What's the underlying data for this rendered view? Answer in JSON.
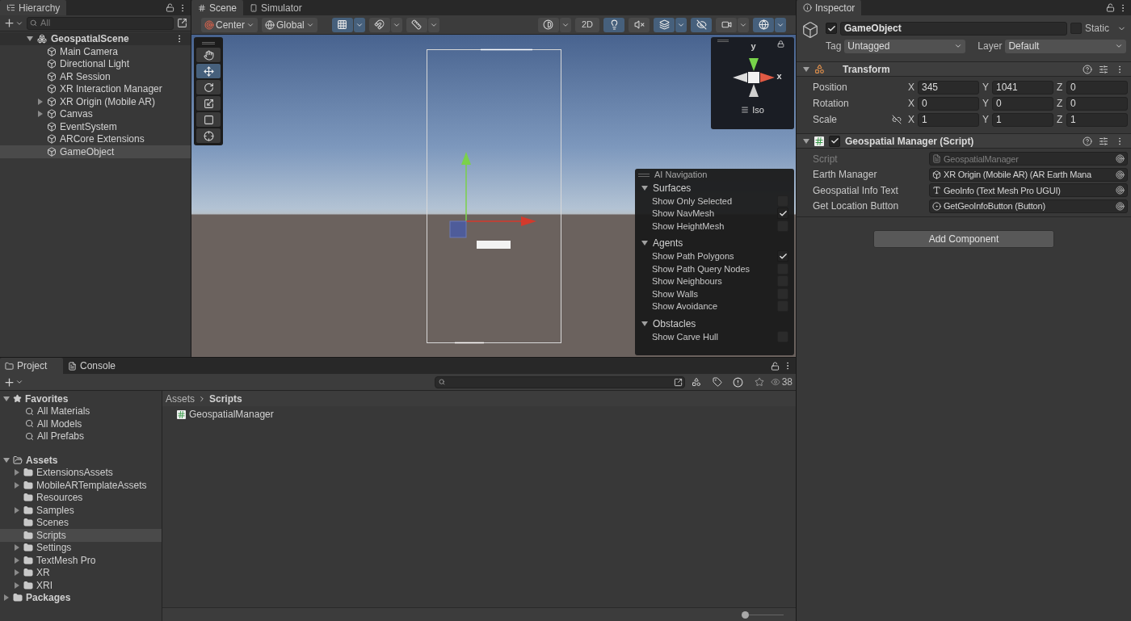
{
  "hierarchy": {
    "tab": "Hierarchy",
    "search_placeholder": "All",
    "scene": "GeospatialScene",
    "items": [
      {
        "label": "Main Camera",
        "expandable": false,
        "selected": false
      },
      {
        "label": "Directional Light",
        "expandable": false,
        "selected": false
      },
      {
        "label": "AR Session",
        "expandable": false,
        "selected": false
      },
      {
        "label": "XR Interaction Manager",
        "expandable": false,
        "selected": false
      },
      {
        "label": "XR Origin (Mobile AR)",
        "expandable": true,
        "selected": false
      },
      {
        "label": "Canvas",
        "expandable": true,
        "selected": false
      },
      {
        "label": "EventSystem",
        "expandable": false,
        "selected": false
      },
      {
        "label": "ARCore Extensions",
        "expandable": false,
        "selected": false
      },
      {
        "label": "GameObject",
        "expandable": false,
        "selected": true
      }
    ]
  },
  "scene_tabs": [
    {
      "label": "Scene",
      "kind": "scene",
      "selected": true
    },
    {
      "label": "Simulator",
      "kind": "simulator",
      "selected": false
    }
  ],
  "scene_toolbar": {
    "pivot": "Center",
    "space": "Global",
    "snap_toggles": [
      {
        "kind": "grid",
        "active": true
      },
      {
        "kind": "snap",
        "active": false
      },
      {
        "kind": "ruler",
        "active": false
      }
    ],
    "view_toggles": [
      {
        "kind": "shading",
        "active": false,
        "dropdown": true
      },
      {
        "kind": "twod",
        "label": "2D",
        "active": false,
        "dropdown": false
      },
      {
        "kind": "lighting",
        "active": true,
        "dropdown": false
      },
      {
        "kind": "audio",
        "active": false,
        "dropdown": false
      },
      {
        "kind": "effects",
        "active": true,
        "dropdown": true
      },
      {
        "kind": "visibility",
        "active": true,
        "dropdown": false
      },
      {
        "kind": "camera",
        "active": false,
        "dropdown": true
      },
      {
        "kind": "gizmos",
        "active": true,
        "dropdown": true
      }
    ]
  },
  "tools": [
    {
      "kind": "hand",
      "selected": false
    },
    {
      "kind": "move",
      "selected": true
    },
    {
      "kind": "rotate",
      "selected": false
    },
    {
      "kind": "scale",
      "selected": false
    },
    {
      "kind": "rect",
      "selected": false
    },
    {
      "kind": "transform",
      "selected": false
    }
  ],
  "orientation_gizmo": {
    "y_label": "y",
    "x_label": "x",
    "projection": "Iso"
  },
  "ai_navigation": {
    "title": "AI Navigation",
    "sections": [
      {
        "title": "Surfaces",
        "expanded": true,
        "options": [
          {
            "label": "Show Only Selected",
            "checked": false
          },
          {
            "label": "Show NavMesh",
            "checked": true
          },
          {
            "label": "Show HeightMesh",
            "checked": false
          }
        ]
      },
      {
        "title": "Agents",
        "expanded": true,
        "options": [
          {
            "label": "Show Path Polygons",
            "checked": true
          },
          {
            "label": "Show Path Query Nodes",
            "checked": false
          },
          {
            "label": "Show Neighbours",
            "checked": false
          },
          {
            "label": "Show Walls",
            "checked": false
          },
          {
            "label": "Show Avoidance",
            "checked": false
          }
        ]
      },
      {
        "title": "Obstacles",
        "expanded": true,
        "options": [
          {
            "label": "Show Carve Hull",
            "checked": false
          }
        ]
      }
    ]
  },
  "inspector": {
    "tab": "Inspector",
    "active": true,
    "enabled": true,
    "name": "GameObject",
    "static_label": "Static",
    "static": false,
    "tag_label": "Tag",
    "tag": "Untagged",
    "layer_label": "Layer",
    "layer": "Default",
    "transform": {
      "title": "Transform",
      "expanded": true,
      "rows": [
        {
          "label": "Position",
          "fields": [
            {
              "axis": "X",
              "value": "345"
            },
            {
              "axis": "Y",
              "value": "1041"
            },
            {
              "axis": "Z",
              "value": "0"
            }
          ]
        },
        {
          "label": "Rotation",
          "fields": [
            {
              "axis": "X",
              "value": "0"
            },
            {
              "axis": "Y",
              "value": "0"
            },
            {
              "axis": "Z",
              "value": "0"
            }
          ]
        },
        {
          "label": "Scale",
          "proportions_locked": false,
          "fields": [
            {
              "axis": "X",
              "value": "1"
            },
            {
              "axis": "Y",
              "value": "1"
            },
            {
              "axis": "Z",
              "value": "1"
            }
          ]
        }
      ]
    },
    "script": {
      "title": "Geospatial Manager (Script)",
      "expanded": true,
      "enabled": true,
      "fields": [
        {
          "label": "Script",
          "value": "GeospatialManager",
          "kind": "script",
          "disabled": true
        },
        {
          "label": "Earth Manager",
          "value": "XR Origin (Mobile AR) (AR Earth Mana",
          "kind": "component",
          "disabled": false
        },
        {
          "label": "Geospatial Info Text",
          "value": "GeoInfo (Text Mesh Pro UGUI)",
          "kind": "text",
          "disabled": false
        },
        {
          "label": "Get Location Button",
          "value": "GetGeoInfoButton (Button)",
          "kind": "button",
          "disabled": false
        }
      ]
    },
    "add_component": "Add Component"
  },
  "project": {
    "tabs": [
      {
        "label": "Project",
        "kind": "project",
        "selected": true
      },
      {
        "label": "Console",
        "kind": "console",
        "selected": false
      }
    ],
    "hidden_count": "38",
    "favorites": {
      "label": "Favorites",
      "expanded": true,
      "items": [
        "All Materials",
        "All Models",
        "All Prefabs"
      ]
    },
    "assets": {
      "label": "Assets",
      "expanded": true,
      "children": [
        {
          "label": "ExtensionsAssets",
          "expandable": true,
          "selected": false
        },
        {
          "label": "MobileARTemplateAssets",
          "expandable": true,
          "selected": false
        },
        {
          "label": "Resources",
          "expandable": false,
          "selected": false
        },
        {
          "label": "Samples",
          "expandable": true,
          "selected": false
        },
        {
          "label": "Scenes",
          "expandable": false,
          "selected": false
        },
        {
          "label": "Scripts",
          "expandable": false,
          "selected": true
        },
        {
          "label": "Settings",
          "expandable": true,
          "selected": false
        },
        {
          "label": "TextMesh Pro",
          "expandable": true,
          "selected": false
        },
        {
          "label": "XR",
          "expandable": true,
          "selected": false
        },
        {
          "label": "XRI",
          "expandable": true,
          "selected": false
        }
      ]
    },
    "packages": {
      "label": "Packages",
      "expanded": false
    },
    "breadcrumb": [
      "Assets",
      "Scripts"
    ],
    "files": [
      {
        "name": "GeospatialManager",
        "kind": "script"
      }
    ],
    "zoom": {
      "level": 0
    }
  }
}
